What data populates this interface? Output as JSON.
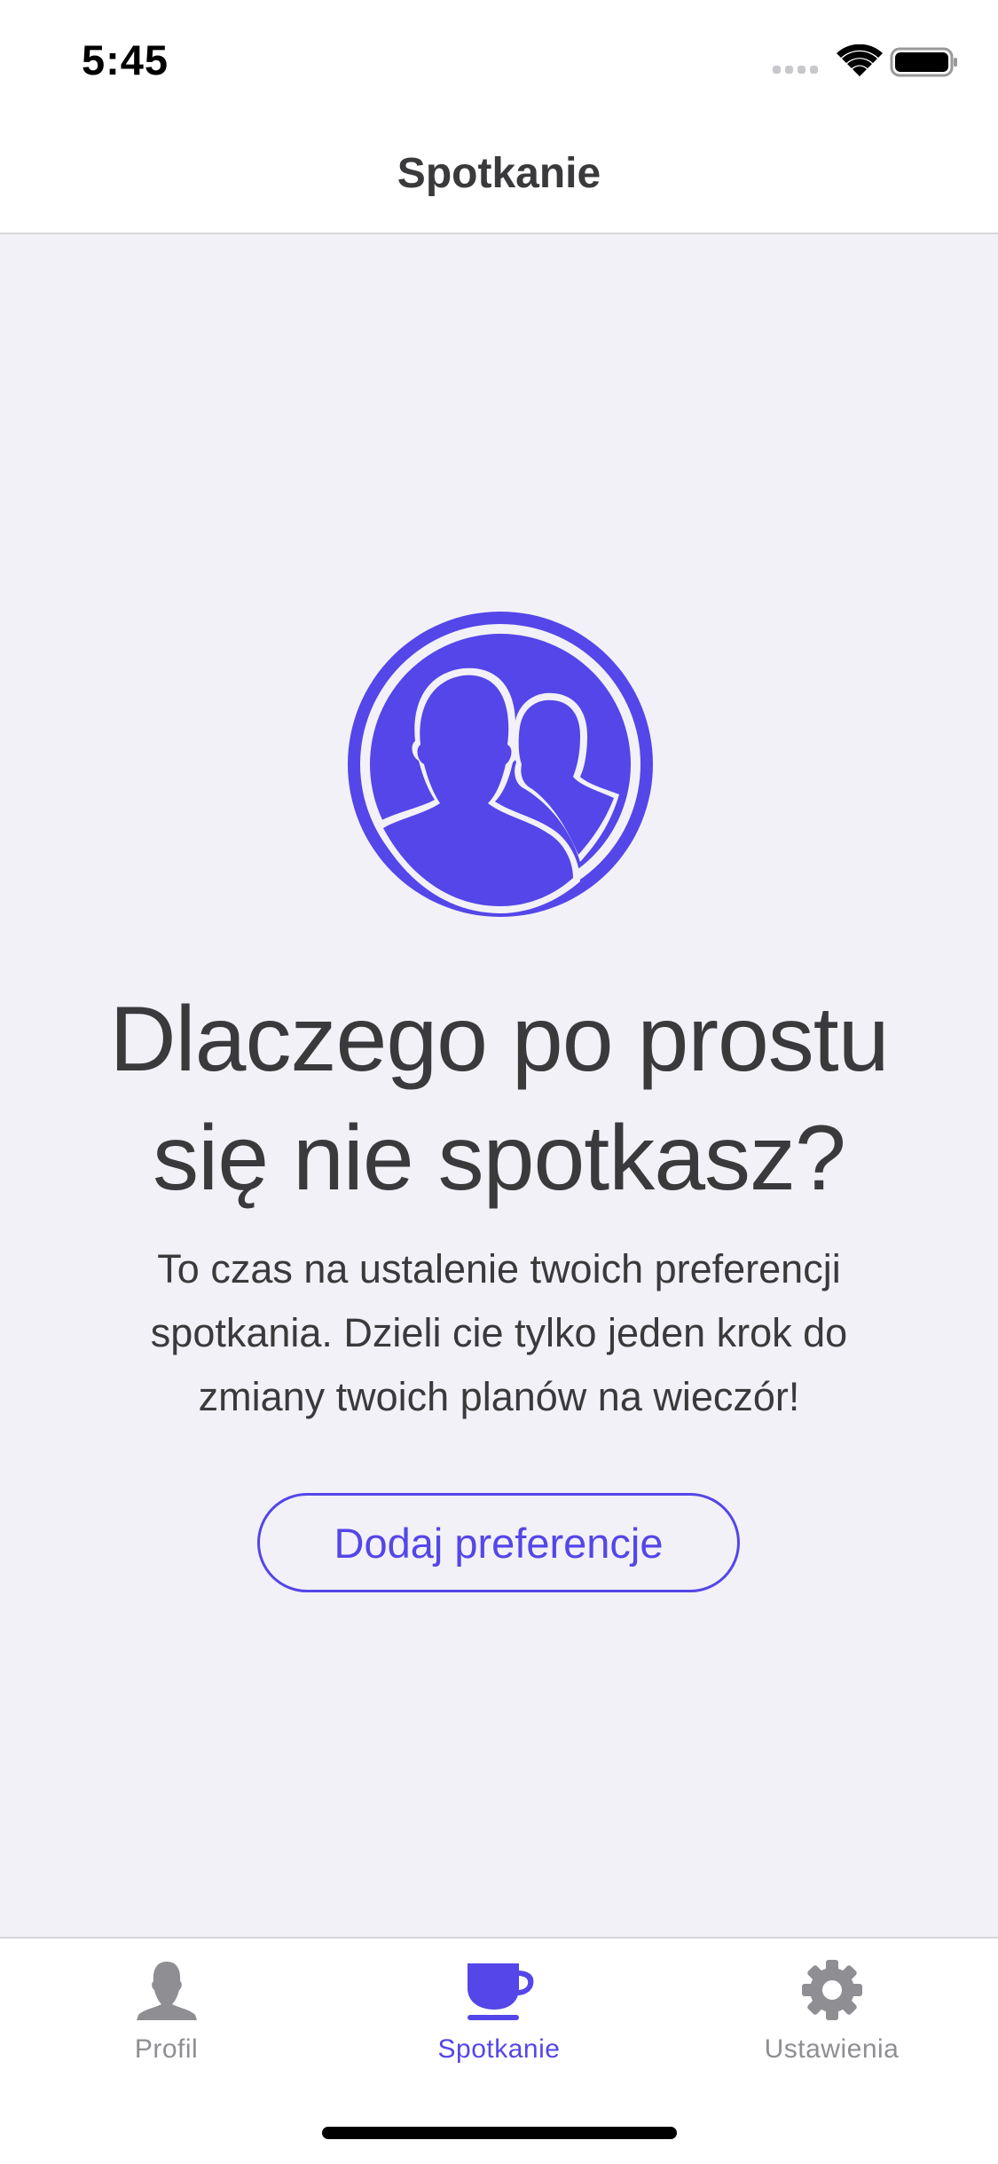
{
  "status_bar": {
    "time": "5:45"
  },
  "nav": {
    "title": "Spotkanie"
  },
  "empty_state": {
    "icon": "people-circle-icon",
    "headline_line1": "Dlaczego po prostu",
    "headline_line2": "się nie spotkasz?",
    "body_line1": "To czas na ustalenie twoich preferencji",
    "body_line2": "spotkania. Dzieli cie tylko jeden krok do",
    "body_line3": "zmiany twoich planów na wieczór!",
    "button_label": "Dodaj preferencje"
  },
  "tab_bar": {
    "tabs": [
      {
        "label": "Profil",
        "icon": "person-icon",
        "active": false
      },
      {
        "label": "Spotkanie",
        "icon": "coffee-cup-icon",
        "active": true
      },
      {
        "label": "Ustawienia",
        "icon": "gear-icon",
        "active": false
      }
    ]
  },
  "colors": {
    "accent": "#5446e8",
    "inactive": "#8e8e93",
    "background": "#f2f1f7",
    "bar_background": "#ffffff",
    "text": "#3a3a3c"
  }
}
